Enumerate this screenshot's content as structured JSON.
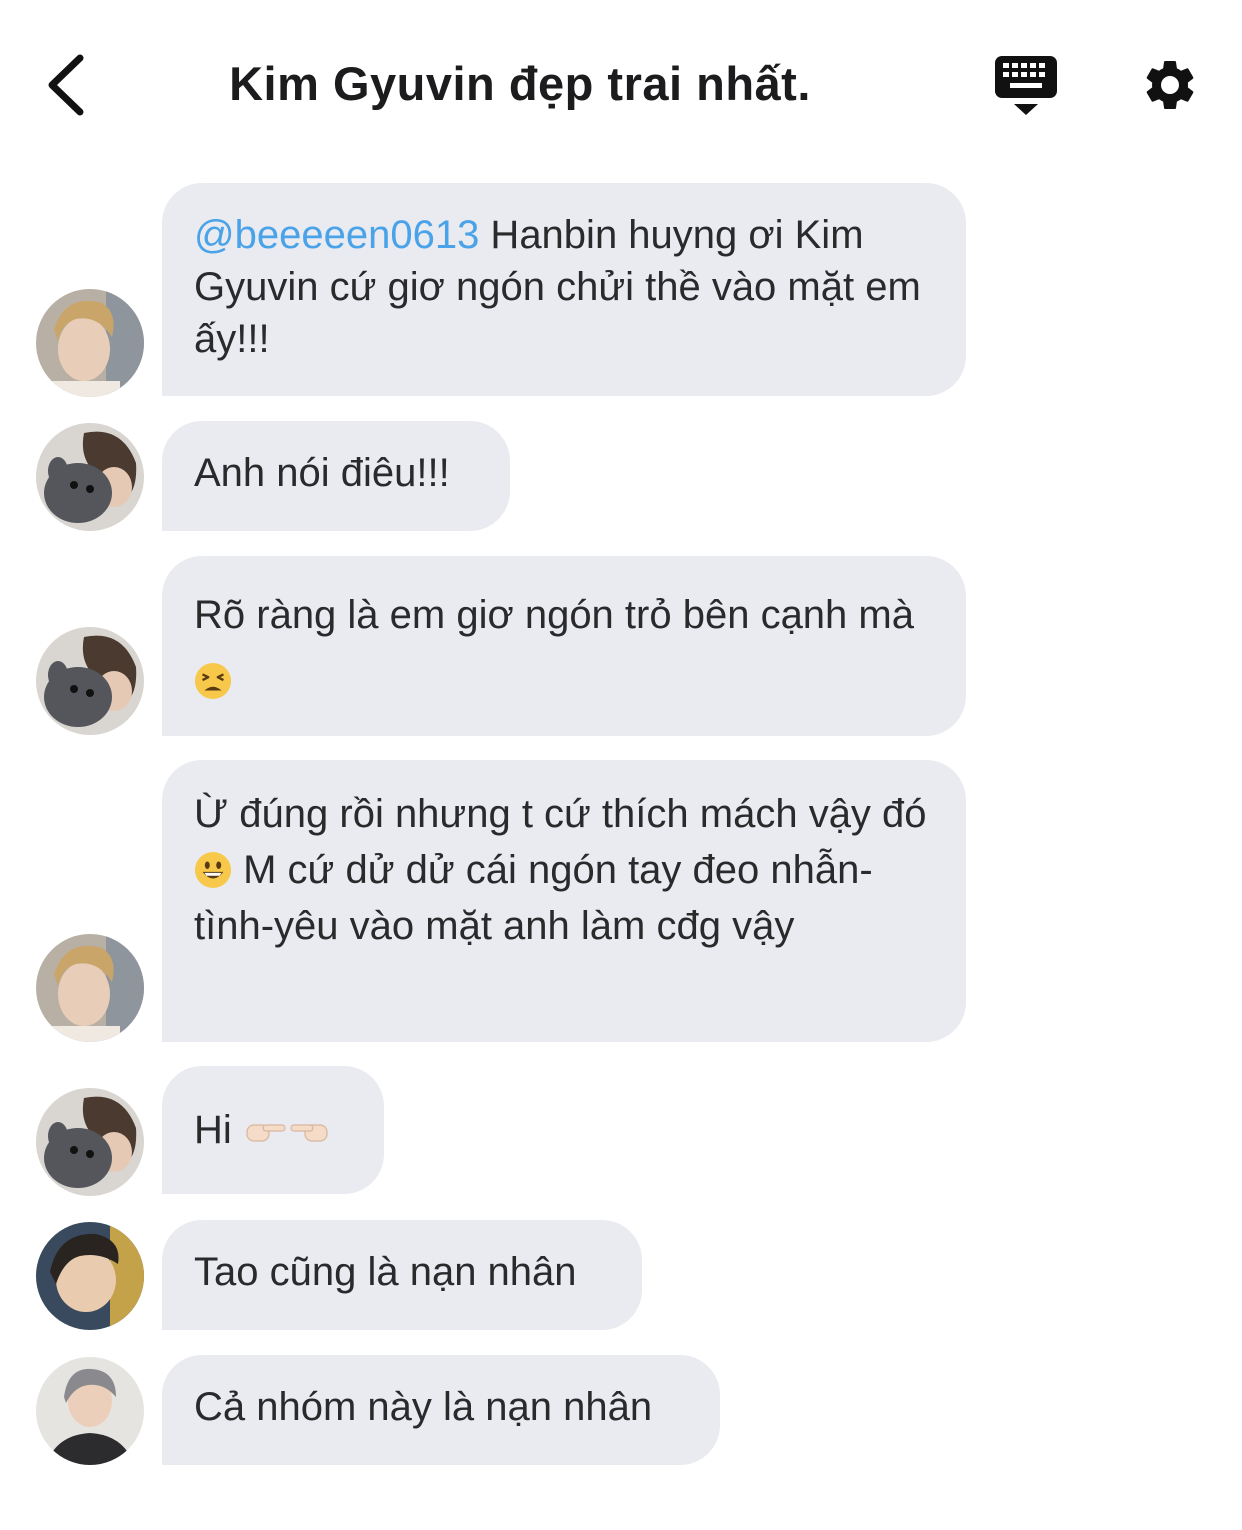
{
  "header": {
    "title": "Kim Gyuvin đẹp trai nhất.",
    "icons": {
      "back": "chevron-left-icon",
      "keyboard": "keyboard-icon",
      "settings": "gear-icon"
    }
  },
  "messages": [
    {
      "avatar": "avatar-a",
      "mention": "@beeeeen0613",
      "text": " Hanbin huyng ơi Kim Gyuvin cứ giơ ngón chửi thề vào mặt em ấy!!!"
    },
    {
      "avatar": "avatar-b",
      "text": "Anh nói điêu!!!"
    },
    {
      "avatar": "avatar-b",
      "text_before": "Rõ ràng là em giơ ngón trỏ bên cạnh mà ",
      "emoji": "tired-face-emoji"
    },
    {
      "avatar": "avatar-a",
      "text_before": "Ừ đúng rồi nhưng t cứ thích mách vậy đó ",
      "emoji": "grinning-face-emoji",
      "text_after": " M cứ dử dử cái ngón tay đeo nhẫn-tình-yêu vào mặt anh làm cđg vậy"
    },
    {
      "avatar": "avatar-b",
      "text_before": "Hi ",
      "emoji": "pointing-fingers-emoji"
    },
    {
      "avatar": "avatar-c",
      "text": "Tao cũng là nạn nhân"
    },
    {
      "avatar": "avatar-d",
      "text": "Cả nhóm này là nạn nhân"
    }
  ],
  "colors": {
    "bubble": "#e9ebf0",
    "mention": "#4aa3e8",
    "text": "#2a2a2c"
  }
}
